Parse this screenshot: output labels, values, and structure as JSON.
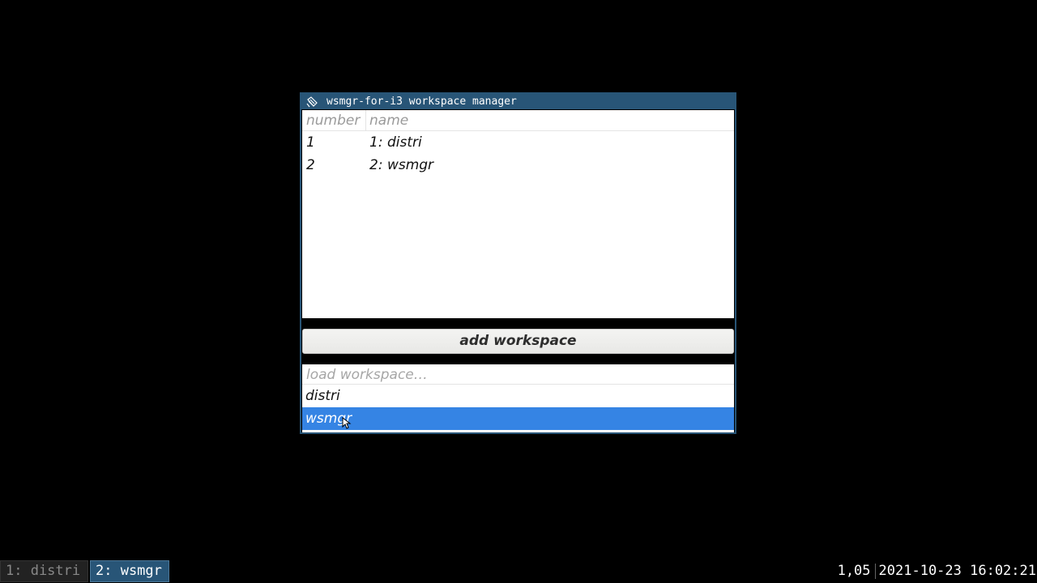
{
  "window": {
    "title": "wsmgr-for-i3 workspace manager",
    "icon": "wsmgr-app-icon",
    "title_bg": "#285577"
  },
  "workspace_table": {
    "columns": [
      "number",
      "name"
    ],
    "rows": [
      {
        "number": "1",
        "name": "1: distri"
      },
      {
        "number": "2",
        "name": "2: wsmgr"
      }
    ]
  },
  "add_button": {
    "label": "add workspace"
  },
  "load_list": {
    "header": "load workspace…",
    "items": [
      "distri",
      "wsmgr"
    ],
    "selected": "wsmgr",
    "selection_color": "#3584e4"
  },
  "i3bar": {
    "workspaces": [
      {
        "label": "1: distri",
        "focused": false
      },
      {
        "label": "2: wsmgr",
        "focused": true
      }
    ],
    "status": {
      "load": "1,05",
      "datetime": "2021-10-23 16:02:21"
    }
  }
}
